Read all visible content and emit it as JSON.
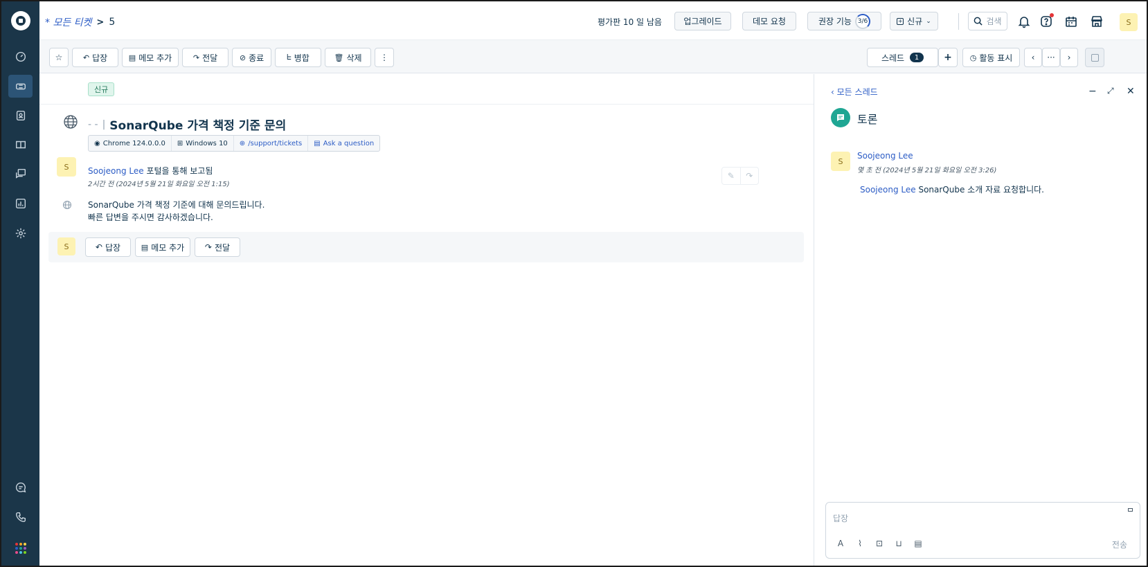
{
  "header": {
    "breadcrumb_link": "* 모든 티켓",
    "breadcrumb_sep": ">",
    "ticket_number": "5",
    "trial_text": "평가판 10 일 남음",
    "upgrade": "업그레이드",
    "demo": "데모 요청",
    "recommended": "권장 기능",
    "recommended_progress": "3/6",
    "new": "신규",
    "search": "검색",
    "avatar_initial": "S"
  },
  "toolbar": {
    "reply": "답장",
    "add_note": "메모 추가",
    "forward": "전달",
    "close": "종료",
    "merge": "병합",
    "delete": "삭제",
    "thread": "스레드",
    "thread_count": "1",
    "show_activity": "활동 표시"
  },
  "ticket": {
    "status": "신규",
    "subject_prefix": "- -",
    "subject": "SonarQube 가격 책정 기준 문의",
    "meta": {
      "browser": "Chrome 124.0.0.0",
      "os": "Windows 10",
      "url": "/support/tickets",
      "form": "Ask a question"
    },
    "message": {
      "avatar_initial": "S",
      "author": "Soojeong Lee",
      "via": "포털을 통해 보고됨",
      "time": "2시간 전 (2024년 5월 21일 화요일 오전 1:15)",
      "line1": "SonarQube 가격 책정 기준에 대해 문의드립니다.",
      "line2": "빠른 답변을 주시면 감사하겠습니다."
    },
    "reply_bar": {
      "avatar_initial": "S",
      "reply": "답장",
      "add_note": "메모 추가",
      "forward": "전달"
    }
  },
  "thread_panel": {
    "back": "모든 스레드",
    "title": "토론",
    "entry": {
      "avatar_initial": "S",
      "author": "Soojeong Lee",
      "time": "몇 초 전 (2024년 5월 21일 화요일 오전 3:26)",
      "mention": "Soojeong Lee",
      "body": " SonarQube 소개 자료 요청합니다."
    },
    "composer": {
      "placeholder": "답장",
      "send": "전송"
    }
  }
}
